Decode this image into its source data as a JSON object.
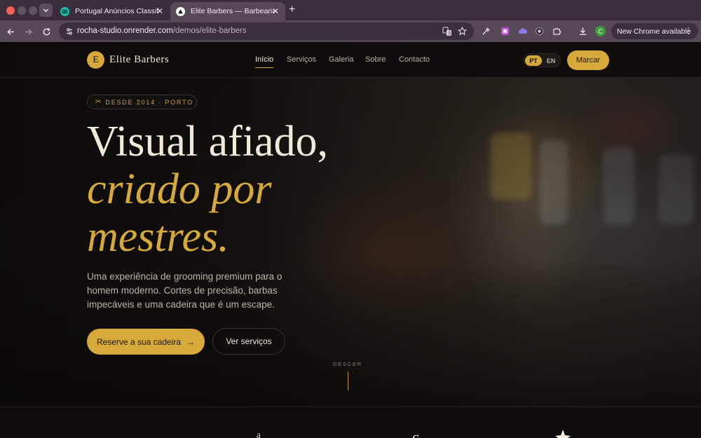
{
  "browser": {
    "tabs": [
      {
        "title": "Portugal Anúncios Classificados",
        "icon": "ring-icon",
        "active": false
      },
      {
        "title": "Elite Barbers — Barbearia de Luxo",
        "icon": "triangle-icon",
        "active": true
      }
    ],
    "url_host": "rocha-studio.onrender.com",
    "url_path": "/demos/elite-barbers",
    "profile_initial": "C",
    "update_label": "New Chrome available"
  },
  "site": {
    "brand_initial": "E",
    "brand_name": "Elite Barbers",
    "nav": [
      "Início",
      "Serviços",
      "Galeria",
      "Sobre",
      "Contacto"
    ],
    "active_nav": "Início",
    "languages": [
      "PT",
      "EN"
    ],
    "active_language": "PT",
    "book_label": "Marcar"
  },
  "hero": {
    "eyebrow": "DESDE 2014 · PORTO",
    "headline_line1": "Visual afiado,",
    "headline_line2": "criado por",
    "headline_line3": "mestres.",
    "lede": "Uma experiência de grooming premium para o homem moderno. Cortes de precisão, barbas impecáveis e uma cadeira que é um escape.",
    "cta_primary": "Reserve a sua cadeira",
    "cta_secondary": "Ver serviços",
    "scroll_label": "DESCER"
  },
  "colors": {
    "accent": "#d6a93a",
    "background": "#0b0a09",
    "text_primary": "#f1eadb",
    "browser_tabbar": "#3a2d3c",
    "browser_toolbar": "#574858"
  }
}
